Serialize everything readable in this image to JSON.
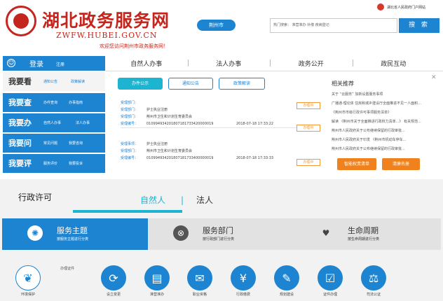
{
  "header": {
    "site_title": "湖北政务服务网",
    "domain": "ZWFW.HUBEI.GOV.CN",
    "welcome": "欢迎您访问荆州市政务服务网！",
    "city_button": "荆州市",
    "search_value": "热门搜索： 准营准办  补缴  疾病登记",
    "search_button": "搜 索",
    "top_link": "湖北省人民政府门户网站",
    "brand_color": "#c4261d",
    "accent_color": "#1d84d2"
  },
  "login": {
    "icon": "user-icon",
    "label": "登录",
    "register": "注册"
  },
  "nav": [
    "自然人办事",
    "法人办事",
    "政务公开",
    "政民互动"
  ],
  "menu": [
    {
      "title": "我要看",
      "subs": [
        "通知公告",
        "政策解读"
      ]
    },
    {
      "title": "我要查",
      "subs": [
        "办件查询",
        "办事指南"
      ]
    },
    {
      "title": "我要办",
      "subs": [
        "自然人办事",
        "法人办事"
      ]
    },
    {
      "title": "我要问",
      "subs": [
        "常见问题",
        "我要咨询"
      ]
    },
    {
      "title": "我要评",
      "subs": [
        "服务评价",
        "我要投诉"
      ]
    }
  ],
  "content_tabs": [
    "办件公示",
    "通知公告",
    "政策解读"
  ],
  "records": [
    {
      "rows": [
        {
          "label": "受理部门：",
          "value": "",
          "time": "",
          "badge": "办理中"
        },
        {
          "label": "受理部门：",
          "value": "护士执业注册",
          "time": "",
          "badge": ""
        },
        {
          "label": "受理部门：",
          "value": "荆州市卫生和计划生育委员会",
          "time": "",
          "badge": ""
        },
        {
          "label": "受理编号：",
          "value": "010994934201807181733420000019",
          "time": "2018-07-18 17:33:22",
          "badge": "办理中"
        }
      ]
    },
    {
      "rows": [
        {
          "label": "受理事项：",
          "value": "护士执业注册",
          "time": "",
          "badge": ""
        },
        {
          "label": "受理部门：",
          "value": "荆州市卫生和计划生育委员会",
          "time": "",
          "badge": ""
        },
        {
          "label": "受理编号：",
          "value": "010994934201807181733400000019",
          "time": "2018-07-18 17:33:33",
          "badge": "办理中"
        }
      ]
    }
  ],
  "recommend": {
    "title": "相关推荐",
    "items": [
      "关于 “云服务” 加新设置服务事项",
      "广播通·理论体  住房和城乡建设厅全面推进不见一人面积...",
      "《荆州市市级行政许可事项服务清单》",
      "解读 《荆州市关于全面推进行政权力清单...》 有关规范...",
      "荆州市人民政府关于公布继续保留的行政审批...",
      "荆州市人民政府关于印发 《荆州市机动车停车...",
      "荆州市人民政府关于公布继续保留的行政审批..."
    ],
    "buttons": [
      "智能权责清单",
      "清廉名册"
    ],
    "close_icon": "close-icon"
  },
  "section": {
    "title": "行政许可",
    "tabs": [
      "自然人",
      "法人"
    ],
    "separator": "|",
    "active_color": "#1db4d2"
  },
  "categories": [
    {
      "label": "服务主题",
      "sub": "按服务主题进行分类",
      "icon": "aperture-icon"
    },
    {
      "label": "服务部门",
      "sub": "按行政部门进行分类",
      "icon": "department-icon"
    },
    {
      "label": "生命周期",
      "sub": "按生命周期进行分类",
      "icon": "lifecycle-icon"
    }
  ],
  "services_heading": "办理证件",
  "services": [
    {
      "label": "环境保护",
      "icon": "leaf-icon"
    },
    {
      "label": "设立变更",
      "icon": "refresh-icon"
    },
    {
      "label": "准营准办",
      "icon": "license-icon"
    },
    {
      "label": "职业资格",
      "icon": "certificate-icon"
    },
    {
      "label": "行政缴费",
      "icon": "payment-icon"
    },
    {
      "label": "规划建设",
      "icon": "building-icon"
    },
    {
      "label": "证件办理",
      "icon": "id-card-icon"
    },
    {
      "label": "司法公证",
      "icon": "scale-icon"
    }
  ]
}
